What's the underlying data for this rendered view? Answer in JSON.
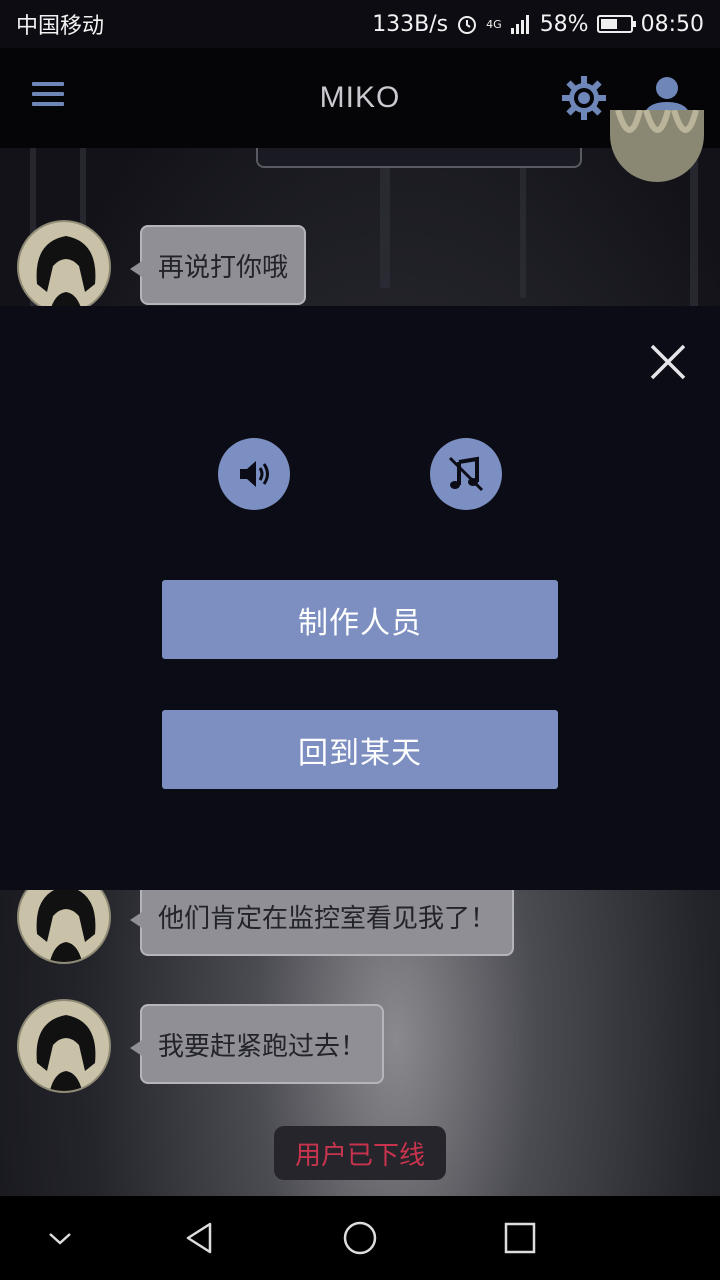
{
  "status_bar": {
    "carrier": "中国移动",
    "speed": "133B/s",
    "network": "4G",
    "battery": "58%",
    "battery_level": 0.58,
    "time": "08:50"
  },
  "header": {
    "title": "MIKO",
    "icons": [
      "menu-icon",
      "gear-icon",
      "user-icon"
    ]
  },
  "chat": {
    "messages": [
      {
        "text": "再说打你哦"
      },
      {
        "text": "他们肯定在监控室看见我了！"
      },
      {
        "text": "我要赶紧跑过去！"
      }
    ],
    "system_notice": "用户已下线"
  },
  "menu_panel": {
    "sound_icon": "speaker-on-icon",
    "music_icon": "music-off-icon",
    "credits_label": "制作人员",
    "back_label": "回到某天",
    "accent_color": "#7d8fc1"
  },
  "nav": {
    "icons": [
      "hide-keyboard-icon",
      "back-icon",
      "home-icon",
      "recents-icon"
    ]
  }
}
